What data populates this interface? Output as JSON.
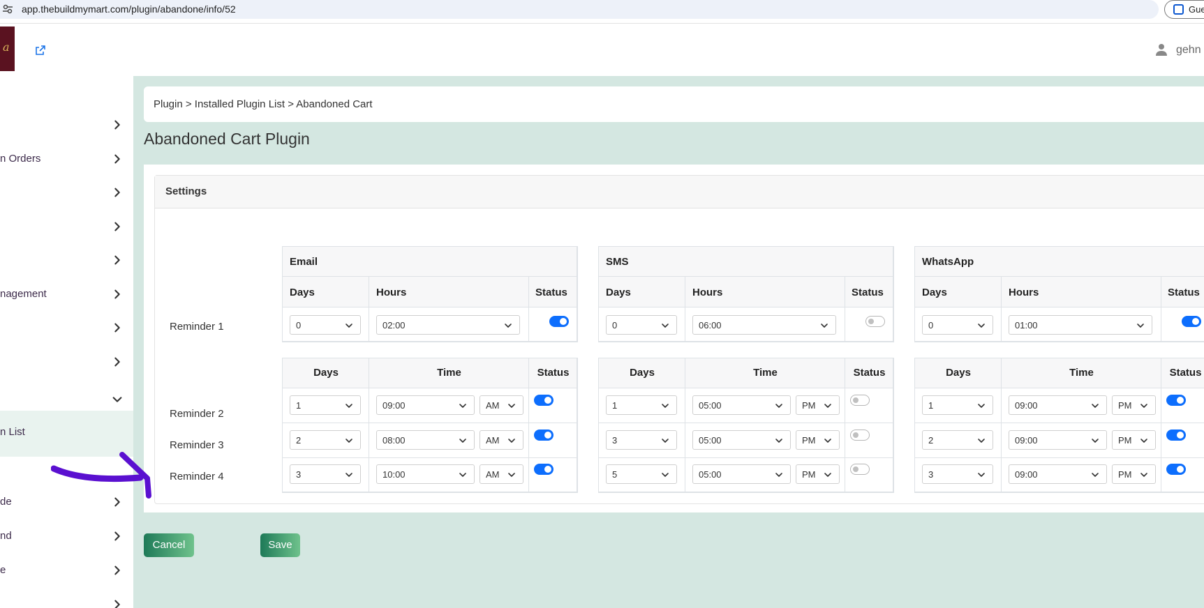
{
  "browser": {
    "url": "app.thebuildmymart.com/plugin/abandone/info/52",
    "profile_label": "Gue"
  },
  "header": {
    "logo_text": "a",
    "username": "gehn"
  },
  "sidebar": {
    "items": [
      {
        "label": ""
      },
      {
        "label": "n Orders"
      },
      {
        "label": ""
      },
      {
        "label": ""
      },
      {
        "label": ""
      },
      {
        "label": "nagement"
      },
      {
        "label": ""
      },
      {
        "label": ""
      },
      {
        "label": ""
      },
      {
        "label": "n List"
      },
      {
        "label": "de"
      },
      {
        "label": "nd"
      },
      {
        "label": "e"
      },
      {
        "label": ""
      }
    ]
  },
  "breadcrumb": "Plugin > Installed Plugin List > Abandoned Cart",
  "page_title": "Abandoned Cart Plugin",
  "settings_title": "Settings",
  "reminders": [
    "Reminder 1",
    "Reminder 2",
    "Reminder 3",
    "Reminder 4"
  ],
  "columns": {
    "days": "Days",
    "hours": "Hours",
    "time": "Time",
    "status": "Status"
  },
  "channels": [
    {
      "name": "Email",
      "r1": {
        "days": "0",
        "hours": "02:00",
        "status": true
      },
      "rows": [
        {
          "days": "1",
          "time": "09:00",
          "ampm": "AM",
          "status": true
        },
        {
          "days": "2",
          "time": "08:00",
          "ampm": "AM",
          "status": true
        },
        {
          "days": "3",
          "time": "10:00",
          "ampm": "AM",
          "status": true
        }
      ]
    },
    {
      "name": "SMS",
      "r1": {
        "days": "0",
        "hours": "06:00",
        "status": false
      },
      "rows": [
        {
          "days": "1",
          "time": "05:00",
          "ampm": "PM",
          "status": false
        },
        {
          "days": "3",
          "time": "05:00",
          "ampm": "PM",
          "status": false
        },
        {
          "days": "5",
          "time": "05:00",
          "ampm": "PM",
          "status": false
        }
      ]
    },
    {
      "name": "WhatsApp",
      "r1": {
        "days": "0",
        "hours": "01:00",
        "status": true
      },
      "rows": [
        {
          "days": "1",
          "time": "09:00",
          "ampm": "PM",
          "status": true
        },
        {
          "days": "2",
          "time": "09:00",
          "ampm": "PM",
          "status": true
        },
        {
          "days": "3",
          "time": "09:00",
          "ampm": "PM",
          "status": true
        }
      ]
    }
  ],
  "buttons": {
    "cancel": "Cancel",
    "save": "Save"
  },
  "colors": {
    "accent": "#0d6efd",
    "main_bg": "#d4e7e1",
    "annotation_arrow": "#5a10d0"
  }
}
